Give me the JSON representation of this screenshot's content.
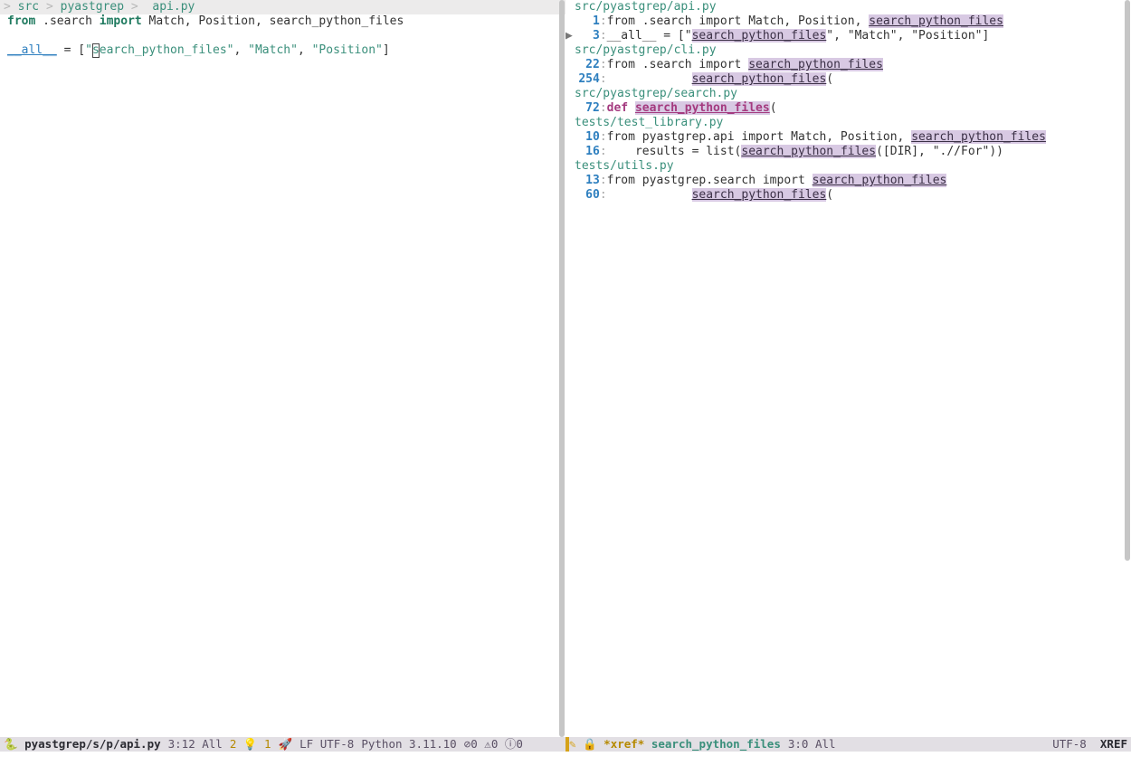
{
  "left": {
    "breadcrumb": {
      "p1": "src",
      "p2": "pyastgrep",
      "p3": "api.py",
      "sep": " > "
    },
    "code": {
      "l1_from": "from",
      "l1_mid": " .search ",
      "l1_import": "import",
      "l1_rest": " Match, Position, search_python_files",
      "l3_dunder": "__all__",
      "l3_eq": " = [",
      "l3_q1": "\"",
      "l3_cursor": "s",
      "l3_s1rest": "earch_python_files\"",
      "l3_comma1": ", ",
      "l3_s2": "\"Match\"",
      "l3_comma2": ", ",
      "l3_s3": "\"Position\"",
      "l3_close": "]"
    },
    "modeline": {
      "icon": "🐍",
      "fname": "pyastgrep/s/p/api.py",
      "pos": "3:12 All",
      "diag1": "2",
      "bulb": "💡",
      "diag2": "1",
      "rocket": "🚀",
      "enc": "LF UTF-8",
      "python": "Python 3.11.10",
      "b1": "⊘",
      "b1n": "0",
      "b2": "⚠",
      "b2n": "0",
      "b3": "ⓘ",
      "b3n": "0"
    }
  },
  "right": {
    "header_file": "src/pyastgrep/api.py",
    "entries": [
      {
        "type": "file",
        "text": "src/pyastgrep/api.py",
        "skip": true
      },
      {
        "type": "line",
        "ln": "1",
        "prefix": "from .search import Match, Position, ",
        "match": "search_python_files",
        "suffix": ""
      },
      {
        "type": "line_current",
        "ln": "3",
        "prefix": "__all__ = [\"",
        "match": "search_python_files",
        "suffix": "\", \"Match\", \"Position\"]"
      },
      {
        "type": "file",
        "text": "src/pyastgrep/cli.py"
      },
      {
        "type": "line",
        "ln": "22",
        "prefix": "from .search import ",
        "match": "search_python_files",
        "suffix": ""
      },
      {
        "type": "line",
        "ln": "254",
        "prefix": "            ",
        "match": "search_python_files",
        "suffix": "("
      },
      {
        "type": "file",
        "text": "src/pyastgrep/search.py"
      },
      {
        "type": "line_def",
        "ln": "72",
        "prefix_kw": "def ",
        "match": "search_python_files",
        "suffix": "("
      },
      {
        "type": "file",
        "text": "tests/test_library.py"
      },
      {
        "type": "line",
        "ln": "10",
        "prefix": "from pyastgrep.api import Match, Position, ",
        "match": "search_python_files",
        "suffix": ""
      },
      {
        "type": "line",
        "ln": "16",
        "prefix": "    results = list(",
        "match": "search_python_files",
        "suffix": "([DIR], \".//For\"))"
      },
      {
        "type": "file",
        "text": "tests/utils.py"
      },
      {
        "type": "line",
        "ln": "13",
        "prefix": "from pyastgrep.search import ",
        "match": "search_python_files",
        "suffix": ""
      },
      {
        "type": "line",
        "ln": "60",
        "prefix": "            ",
        "match": "search_python_files",
        "suffix": "("
      }
    ],
    "modeline": {
      "icon1": "✎",
      "icon2": "🔒",
      "bufname": "*xref*",
      "query": "search_python_files",
      "pos": "3:0 All",
      "enc": "UTF-8",
      "mode": "XREF"
    }
  }
}
